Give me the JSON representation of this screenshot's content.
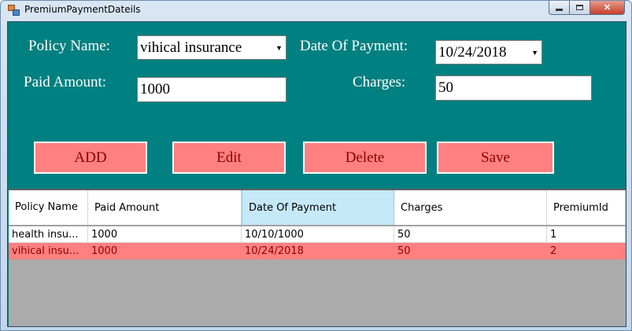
{
  "window": {
    "title": "PremiumPaymentDateils"
  },
  "form": {
    "policy_name_label": "Policy Name:",
    "policy_name_value": "vihical insurance",
    "date_of_payment_label": "Date Of Payment:",
    "date_of_payment_value": "10/24/2018",
    "paid_amount_label": "Paid Amount:",
    "paid_amount_value": "1000",
    "charges_label": "Charges:",
    "charges_value": "50"
  },
  "buttons": {
    "add": "ADD",
    "edit": "Edit",
    "delete": "Delete",
    "save": "Save"
  },
  "grid": {
    "columns": [
      "Policy Name",
      "Paid Amount",
      "Date Of Payment",
      "Charges",
      "PremiumId"
    ],
    "selected_column": "Date Of Payment",
    "rows": [
      [
        "health insu...",
        "1000",
        "10/10/1000",
        "50",
        "1"
      ],
      [
        "vihical insu...",
        "1000",
        "10/24/2018",
        "50",
        "2"
      ]
    ]
  },
  "colors": {
    "form_background": "#008080",
    "button_background": "#ff8080",
    "button_text": "#8b0000",
    "selected_row_background": "#ff8080",
    "grid_empty_background": "#ababab"
  }
}
